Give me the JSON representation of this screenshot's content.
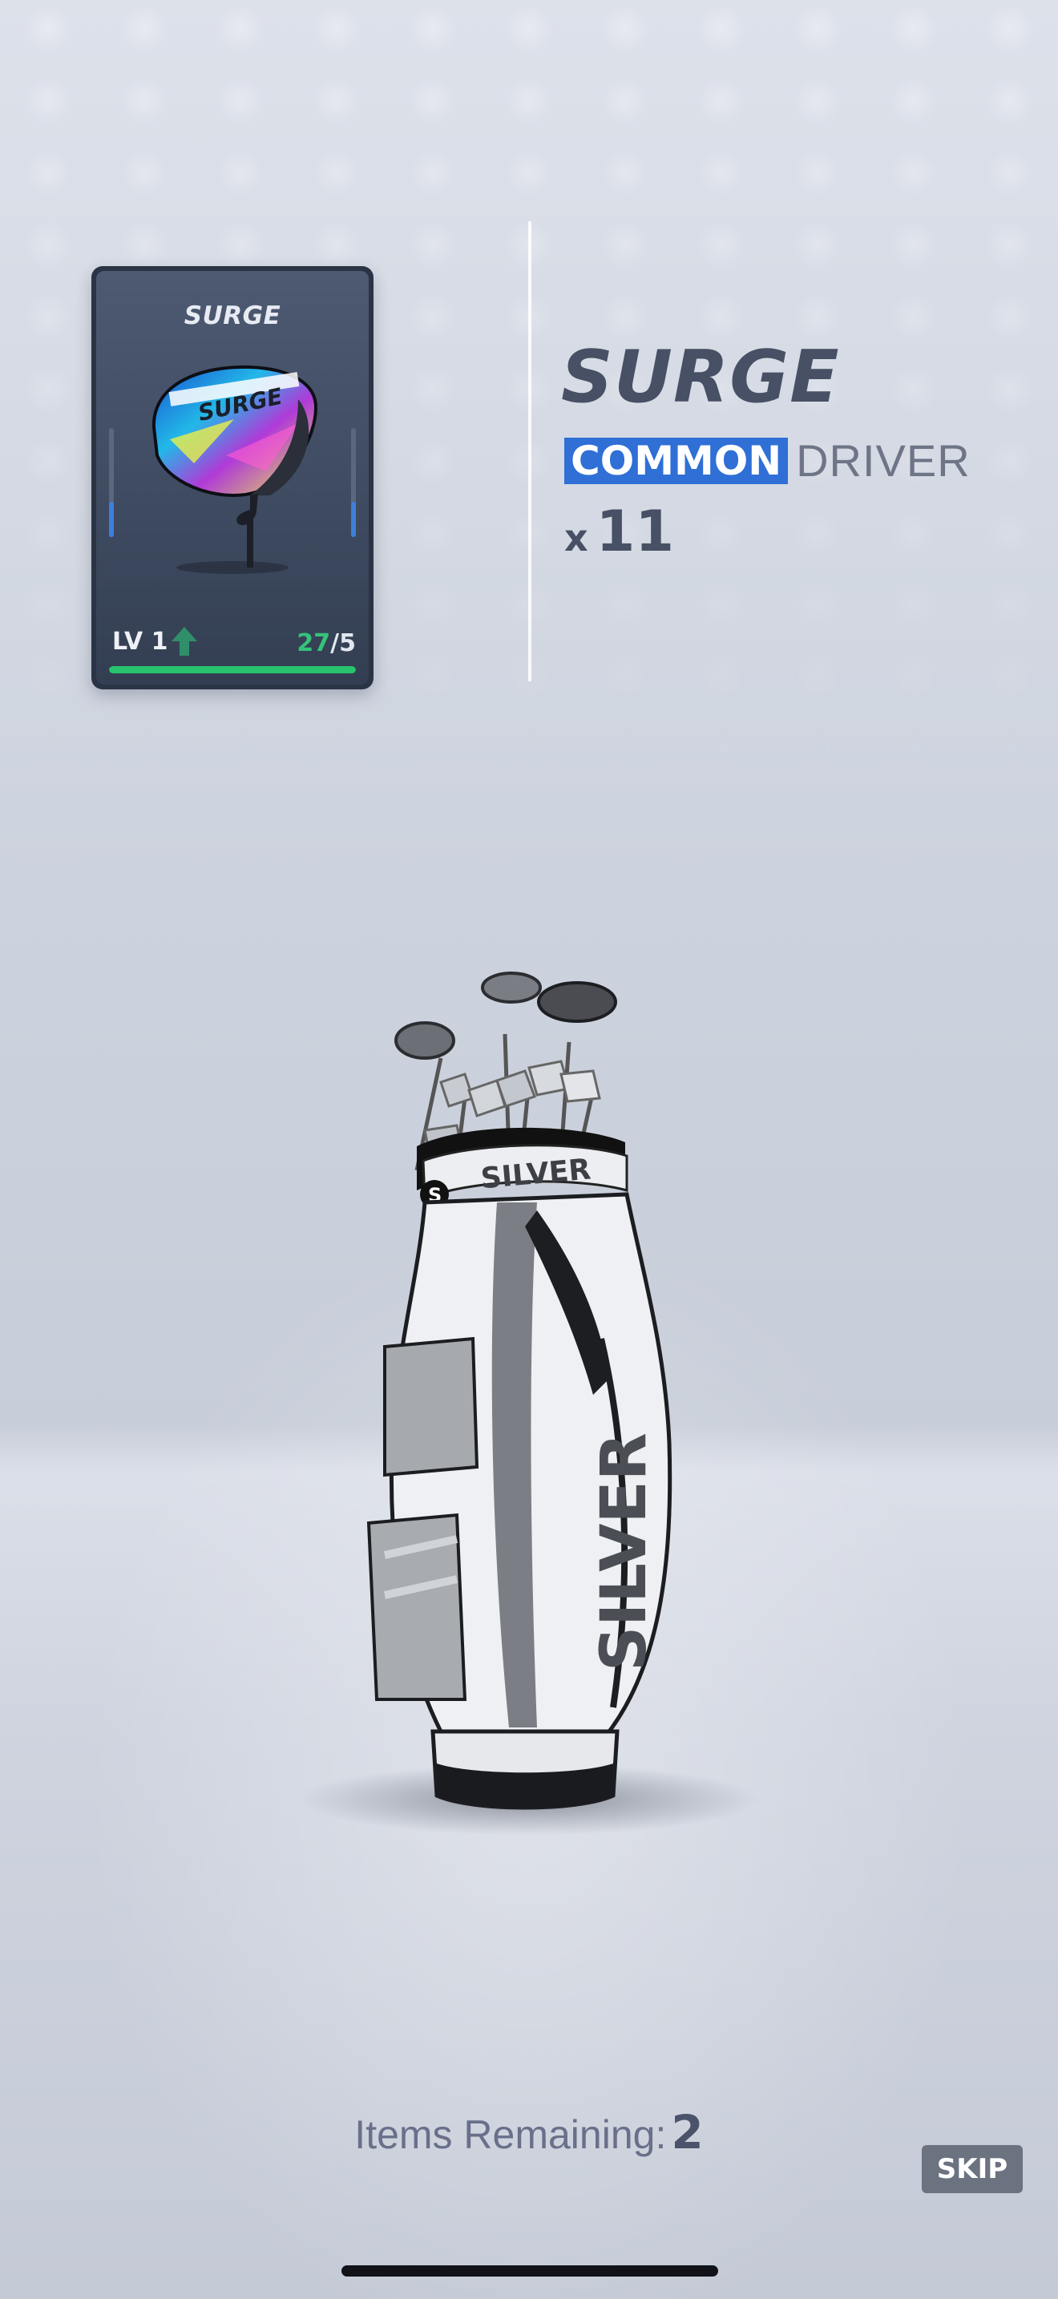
{
  "card": {
    "title": "SURGE",
    "level": "LV 1",
    "count_have": "27",
    "count_sep": "/",
    "count_need": "5",
    "progress": 1.0,
    "brand_on_club": "SURGE",
    "level_icon": "up-arrow-icon"
  },
  "item": {
    "name": "SURGE",
    "rarity": "COMMON",
    "type": "DRIVER",
    "quantity_prefix": "x",
    "quantity": "11"
  },
  "bag": {
    "brand_text": "SILVER",
    "collar_text": "SILVER",
    "logo_letter": "S"
  },
  "footer": {
    "remaining_label": "Items Remaining:",
    "remaining_count": "2",
    "skip_label": "SKIP"
  },
  "colors": {
    "rarity_badge": "#2f6fd6",
    "progress": "#27c46d",
    "count_have": "#35c27a"
  }
}
